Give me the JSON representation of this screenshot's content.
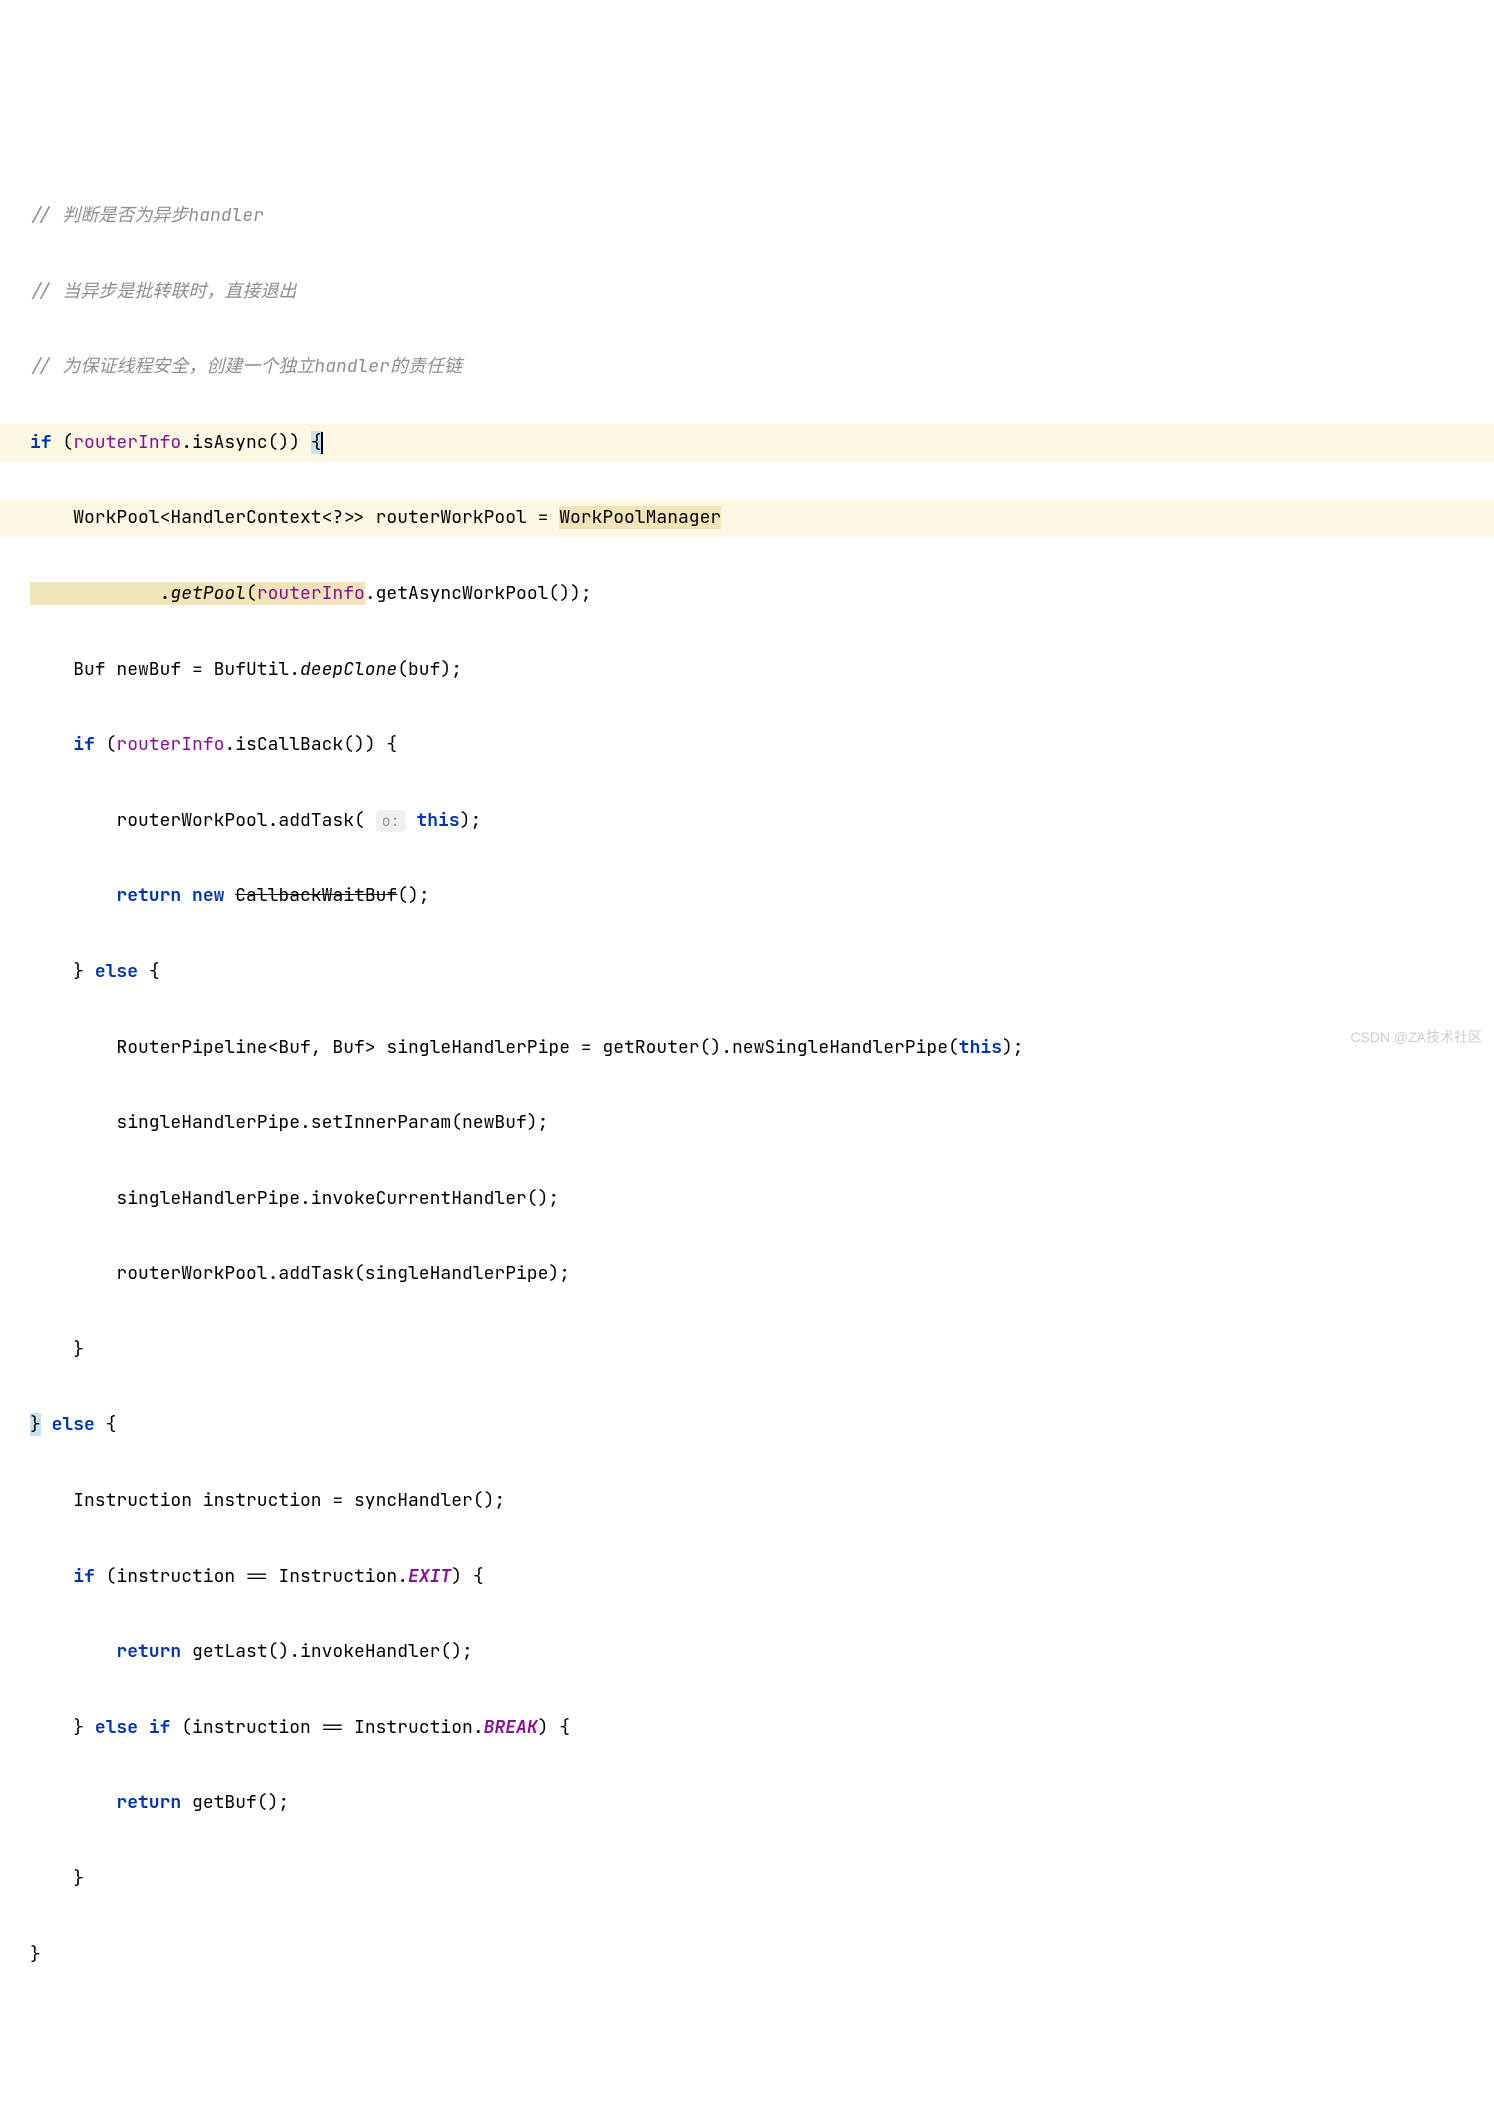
{
  "code": {
    "comment1": "// 判断是否为异步handler",
    "comment2": "// 当异步是批转联时，直接退出",
    "comment3": "// 为保证线程安全，创建一个独立handler的责任链",
    "kw_if": "if",
    "kw_else": "else",
    "kw_return": "return",
    "kw_new": "new",
    "kw_this": "this",
    "routerInfo": "routerInfo",
    "isAsync": ".isAsync()) ",
    "openBrace": "{",
    "line5_pre": "    WorkPool<HandlerContext<?>> routerWorkPool = ",
    "workPoolManager": "WorkPoolManager",
    "line6_pre": "            .",
    "getPool": "getPool",
    "line6_post_open": "(",
    "line6_post": ".getAsyncWorkPool());",
    "line7_pre": "    Buf newBuf = BufUtil.",
    "deepClone": "deepClone",
    "line7_post": "(buf);",
    "line8_pre": " (",
    "isCallBack": ".isCallBack()) {",
    "line9": "        routerWorkPool.addTask(",
    "paramHint": "o:",
    "line9_post": ");",
    "callbackWaitBuf": "CallbackWaitBuf",
    "line10_post": "();",
    "line11": "    } ",
    "line11_post": " {",
    "line12": "        RouterPipeline<Buf, Buf> singleHandlerPipe = getRouter().newSingleHandlerPipe(",
    "line12_post": ");",
    "line13": "        singleHandlerPipe.setInnerParam(newBuf);",
    "line14": "        singleHandlerPipe.invokeCurrentHandler();",
    "line15": "        routerWorkPool.addTask(singleHandlerPipe);",
    "line16": "    }",
    "closeBrace": "}",
    "line17_post": " {",
    "line18": "    Instruction instruction = syncHandler();",
    "line19_pre": " (instruction == Instruction.",
    "EXIT": "EXIT",
    "line19_post": ") {",
    "line20_pre": " getLast().invokeHandler();",
    "line21": "    } ",
    "line21_post": " (instruction == Instruction.",
    "BREAK": "BREAK",
    "line21_end": ") {",
    "line22_pre": " getBuf();",
    "line23": "    }",
    "line24": "}"
  },
  "watermark": "CSDN @ZA技术社区"
}
